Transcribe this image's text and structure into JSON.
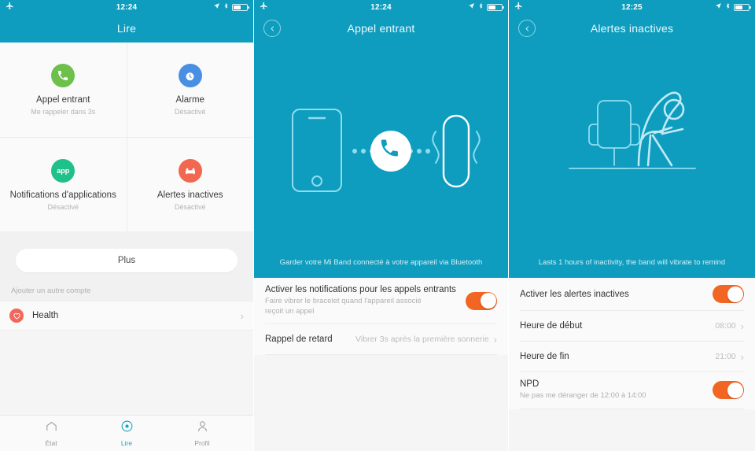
{
  "theme": {
    "teal": "#0e9dbf",
    "orange": "#f26522",
    "page_bg": "#fafafa"
  },
  "panel1": {
    "status": {
      "time": "12:24",
      "airplane_icon": "airplane-icon",
      "location_icon": "location-arrow-icon",
      "bluetooth_icon": "bluetooth-icon",
      "battery_icon": "battery-icon"
    },
    "nav": {
      "title": "Lire"
    },
    "grid": [
      {
        "icon": "phone-icon",
        "color": "#6dc04b",
        "title": "Appel entrant",
        "subtitle": "Me rappeler dans 3s"
      },
      {
        "icon": "alarm-clock-icon",
        "color": "#4a90e2",
        "title": "Alarme",
        "subtitle": "Désactivé"
      },
      {
        "icon": "app-badge-icon",
        "color": "#1fc08a",
        "title": "Notifications d'applications",
        "subtitle": "Désactivé"
      },
      {
        "icon": "sofa-icon",
        "color": "#f2674f",
        "title": "Alertes inactives",
        "subtitle": "Désactivé"
      }
    ],
    "more_button": "Plus",
    "accounts_label": "Ajouter un autre compte",
    "account": {
      "icon": "health-heart-icon",
      "name": "Health",
      "chevron": "›"
    },
    "tabs": [
      {
        "icon": "home-icon",
        "label": "État",
        "active": false
      },
      {
        "icon": "target-icon",
        "label": "Lire",
        "active": true
      },
      {
        "icon": "person-icon",
        "label": "Profil",
        "active": false
      }
    ]
  },
  "panel2": {
    "status": {
      "time": "12:24"
    },
    "nav": {
      "back_icon": "chevron-left-icon",
      "title": "Appel entrant"
    },
    "hero": {
      "art": "phone-call-band-illustration",
      "caption": "Garder votre Mi Band connecté à votre appareil via Bluetooth"
    },
    "rows": [
      {
        "name": "enable-incoming-call-notifications",
        "title": "Activer les notifications pour les appels entrants",
        "subtitle": "Faire vibrer le bracelet quand l'appareil associé reçoit un appel",
        "control": "toggle",
        "toggle_on": true
      },
      {
        "name": "delayed-reminder",
        "title": "Rappel de retard",
        "value": "Vibrer 3s après la première sonnerie",
        "control": "chevron",
        "chevron": "›"
      }
    ]
  },
  "panel3": {
    "status": {
      "time": "12:25"
    },
    "nav": {
      "back_icon": "chevron-left-icon",
      "title": "Alertes inactives"
    },
    "hero": {
      "art": "chair-stretching-person-illustration",
      "caption": "Lasts 1 hours of inactivity, the band will vibrate to remind"
    },
    "rows": [
      {
        "name": "enable-inactivity-alerts",
        "title": "Activer les alertes inactives",
        "control": "toggle",
        "toggle_on": true
      },
      {
        "name": "start-time",
        "title": "Heure de début",
        "value": "08:00",
        "control": "chevron",
        "chevron": "›"
      },
      {
        "name": "end-time",
        "title": "Heure de fin",
        "value": "21:00",
        "control": "chevron",
        "chevron": "›"
      },
      {
        "name": "dnd",
        "title": "NPD",
        "subtitle": "Ne pas me déranger de 12:00 à 14:00",
        "control": "toggle",
        "toggle_on": true
      }
    ]
  }
}
